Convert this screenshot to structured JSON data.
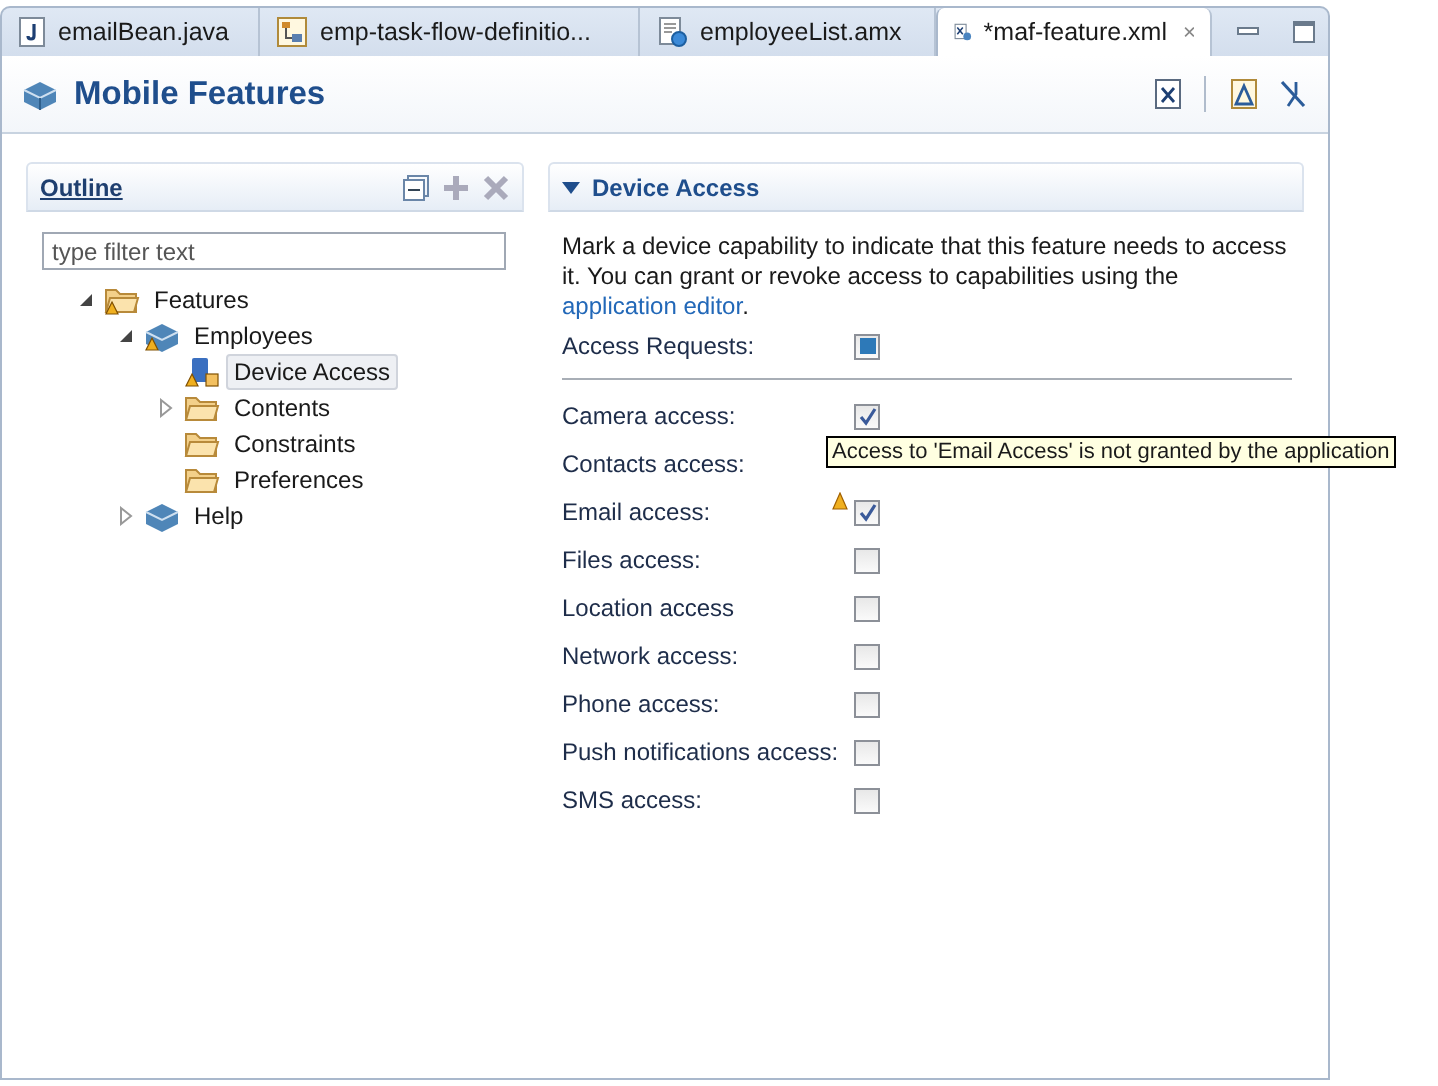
{
  "tabs": [
    {
      "label": "emailBean.java",
      "kind": "java",
      "selected": false
    },
    {
      "label": "emp-task-flow-definitio...",
      "kind": "flow",
      "selected": false
    },
    {
      "label": "employeeList.amx",
      "kind": "amx",
      "selected": false
    },
    {
      "label": "*maf-feature.xml",
      "kind": "xml",
      "selected": true
    }
  ],
  "editor": {
    "title": "Mobile Features"
  },
  "outline": {
    "title": "Outline",
    "filter": {
      "placeholder": "type filter text"
    },
    "tree": [
      {
        "label": "Features",
        "kind": "folder",
        "warning": true,
        "expanded": true,
        "selected": false,
        "children": [
          {
            "label": "Employees",
            "kind": "feature",
            "warning": true,
            "expanded": true,
            "selected": false,
            "children": [
              {
                "label": "Device Access",
                "kind": "device",
                "warning": true,
                "selected": true
              },
              {
                "label": "Contents",
                "kind": "folder",
                "warning": false,
                "expanded": false,
                "selected": false
              },
              {
                "label": "Constraints",
                "kind": "folder",
                "warning": false,
                "selected": false
              },
              {
                "label": "Preferences",
                "kind": "folder",
                "warning": false,
                "selected": false
              }
            ]
          },
          {
            "label": "Help",
            "kind": "feature",
            "warning": false,
            "expanded": false,
            "selected": false
          }
        ]
      }
    ]
  },
  "section": {
    "title": "Device Access",
    "expanded": true,
    "description": "Mark a device capability to indicate that this feature needs to access it. You can grant or revoke access to capabilities using the",
    "link": "application editor",
    "link_suffix": ".",
    "access_requests": {
      "label": "Access Requests:",
      "indeterminate": true
    },
    "capabilities": [
      {
        "label": "Camera access:",
        "checked": true,
        "warning": false
      },
      {
        "label": "Contacts access:",
        "warning": false
      },
      {
        "label": "Email access:",
        "checked": true,
        "warning": true
      },
      {
        "label": "Files access:",
        "checked": false,
        "warning": false
      },
      {
        "label": "Location access",
        "checked": false,
        "warning": false
      },
      {
        "label": "Network access:",
        "checked": false,
        "warning": false
      },
      {
        "label": "Phone access:",
        "checked": false,
        "warning": false
      },
      {
        "label": "Push notifications access:",
        "checked": false,
        "warning": false
      },
      {
        "label": "SMS access:",
        "checked": false,
        "warning": false
      }
    ],
    "tooltip": "Access to 'Email Access' is not granted by the application"
  }
}
